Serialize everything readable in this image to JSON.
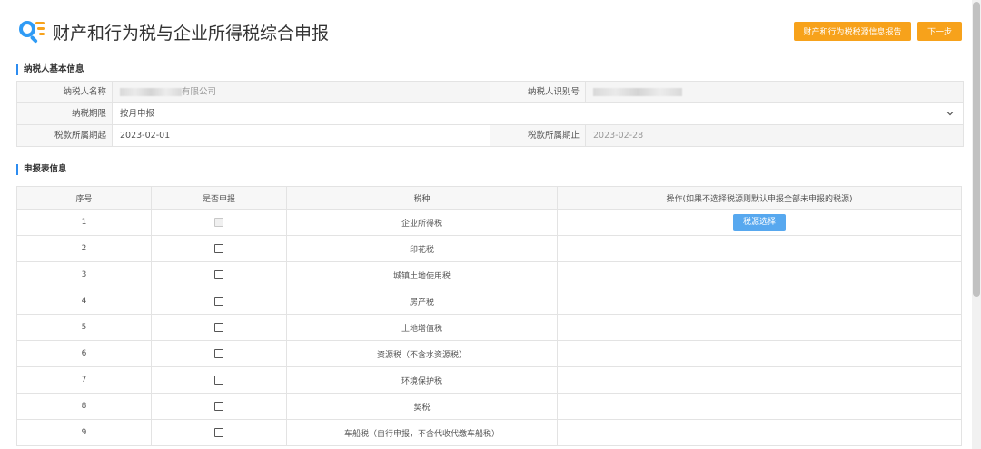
{
  "header": {
    "title": "财产和行为税与企业所得税综合申报",
    "report_button": "财产和行为税税源信息报告",
    "next_button": "下一步"
  },
  "taxpayer_section": {
    "title": "纳税人基本信息",
    "name_label": "纳税人名称",
    "name_value_suffix": "有限公司",
    "id_label": "纳税人识别号",
    "period_label": "纳税期限",
    "period_value": "按月申报",
    "start_label": "税款所属期起",
    "start_value": "2023-02-01",
    "end_label": "税款所属期止",
    "end_value": "2023-02-28"
  },
  "declaration_section": {
    "title": "申报表信息",
    "columns": [
      "序号",
      "是否申报",
      "税种",
      "操作(如果不选择税源则默认申报全部未申报的税源)"
    ],
    "rows": [
      {
        "no": "1",
        "tax": "企业所得税",
        "action": "税源选择",
        "disabled": true
      },
      {
        "no": "2",
        "tax": "印花税",
        "action": ""
      },
      {
        "no": "3",
        "tax": "城镇土地使用税",
        "action": ""
      },
      {
        "no": "4",
        "tax": "房产税",
        "action": ""
      },
      {
        "no": "5",
        "tax": "土地增值税",
        "action": ""
      },
      {
        "no": "6",
        "tax": "资源税（不含水资源税）",
        "action": ""
      },
      {
        "no": "7",
        "tax": "环境保护税",
        "action": ""
      },
      {
        "no": "8",
        "tax": "契税",
        "action": ""
      },
      {
        "no": "9",
        "tax": "车船税（自行申报，不含代收代缴车船税）",
        "action": ""
      }
    ]
  },
  "colors": {
    "accent_orange": "#f7a21b",
    "accent_blue": "#57a8ef",
    "section_bar": "#2d8cf0"
  }
}
